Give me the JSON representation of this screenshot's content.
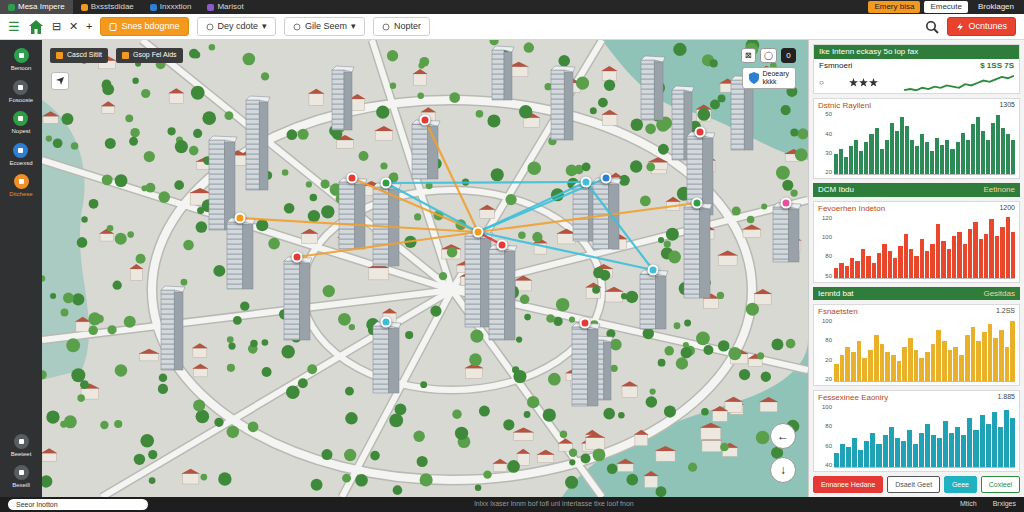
{
  "tabstrip": {
    "tabs": [
      {
        "label": "Mesa Impere",
        "selected": true,
        "color": "#2e9e4f"
      },
      {
        "label": "Bxsstsdidae",
        "selected": false,
        "color": "#f29a1f"
      },
      {
        "label": "Inxxxtion",
        "selected": false,
        "color": "#2d7fd3"
      },
      {
        "label": "Marisot",
        "selected": false,
        "color": "#8a5cc8"
      }
    ],
    "chips": [
      {
        "label": "Emery bisa",
        "kind": "orange"
      },
      {
        "label": "Emecute",
        "kind": "light"
      },
      {
        "label": "Broklagen",
        "kind": "plain"
      }
    ]
  },
  "toolbar": {
    "menu_icon": "☰",
    "window_icons": [
      "⊟",
      "✕",
      "+"
    ],
    "primary": "Snes bdognne",
    "dropdowns": [
      {
        "label": "Dey cdote",
        "caret": "▾"
      },
      {
        "label": "Gile Seem",
        "caret": "▾"
      }
    ],
    "plain": "Nopter",
    "action": "Ocntunes"
  },
  "sidebar": {
    "items": [
      {
        "label": "Benoon",
        "color": "#2e9e4f",
        "selected": false
      },
      {
        "label": "Fosoosie",
        "color": "#5a5d60",
        "selected": false
      },
      {
        "label": "Nopest",
        "color": "#2ea043",
        "selected": false
      },
      {
        "label": "Ecoexsd",
        "color": "#2d7fd3",
        "selected": false
      },
      {
        "label": "Ditchese",
        "color": "#f0902a",
        "selected": true
      }
    ],
    "footer_items": [
      {
        "label": "Beeteet",
        "color": "#5a5d60",
        "selected": false
      },
      {
        "label": "Bexeill",
        "color": "#5a5d60",
        "selected": false
      }
    ]
  },
  "map": {
    "chips": [
      "Cascd Sitiit",
      "Gsop Fel Aids"
    ],
    "tools": [
      {
        "label": "⊠",
        "selected": false
      },
      {
        "label": "◯",
        "selected": false
      },
      {
        "label": "0",
        "selected": true
      }
    ],
    "badge": {
      "title": "Deoeary",
      "sub": "kkkk"
    },
    "zoom": [
      "←",
      "↓"
    ],
    "pins": [
      {
        "color": "#e53935"
      },
      {
        "color": "#e53935"
      },
      {
        "color": "#2ea043"
      },
      {
        "color": "#f39a1e"
      },
      {
        "color": "#3cc0d8"
      },
      {
        "color": "#2d7fd3"
      },
      {
        "color": "#e53935"
      },
      {
        "color": "#2ea043"
      },
      {
        "color": "#e94f9a"
      },
      {
        "color": "#f39a1e"
      },
      {
        "color": "#e53935"
      },
      {
        "color": "#e53935"
      },
      {
        "color": "#3cc0d8"
      },
      {
        "color": "#3cc0d8"
      },
      {
        "color": "#e53935"
      }
    ],
    "links": [
      {
        "from": 3,
        "to": 0,
        "color": "#f0a030"
      },
      {
        "from": 3,
        "to": 1,
        "color": "#f0a030"
      },
      {
        "from": 3,
        "to": 2,
        "color": "#3cc0d8"
      },
      {
        "from": 3,
        "to": 4,
        "color": "#3cc0d8"
      },
      {
        "from": 3,
        "to": 5,
        "color": "#3cc0d8"
      },
      {
        "from": 3,
        "to": 7,
        "color": "#f0a030"
      },
      {
        "from": 3,
        "to": 9,
        "color": "#f0a030"
      },
      {
        "from": 3,
        "to": 10,
        "color": "#f0a030"
      },
      {
        "from": 3,
        "to": 11,
        "color": "#e53935"
      },
      {
        "from": 3,
        "to": 12,
        "color": "#3cc0d8"
      },
      {
        "from": 2,
        "to": 4,
        "color": "#3cc0d8"
      },
      {
        "from": 4,
        "to": 12,
        "color": "#3cc0d8"
      }
    ]
  },
  "panel": {
    "summary": {
      "title": "Ike Intenn eckasy 5o lop fax",
      "label": "Fsmnoeri",
      "reading": "$ 1SS 7S",
      "status_icon": "○",
      "stars": 3,
      "trend": [
        3,
        4,
        3,
        5,
        4,
        6,
        5,
        7,
        6,
        5,
        8,
        7,
        9,
        11,
        10,
        12,
        14,
        13,
        15
      ]
    },
    "charts": [
      {
        "title": "Dstnic Rayllenl",
        "value": "1305",
        "ticks": [
          "50",
          "40",
          "30",
          "20"
        ],
        "axis_max": 55,
        "color": "#2e8b57",
        "values": [
          18,
          22,
          15,
          25,
          30,
          20,
          28,
          35,
          40,
          22,
          30,
          45,
          38,
          50,
          42,
          30,
          25,
          35,
          28,
          20,
          32,
          26,
          30,
          22,
          28,
          36,
          30,
          44,
          50,
          38,
          30,
          45,
          52,
          40,
          35,
          30
        ]
      },
      {
        "header": {
          "title": "DCM Ibdu",
          "right": "Eetinone"
        },
        "title": "Fevoerhen Indeton",
        "value": "1200",
        "ticks": [
          "120",
          "100",
          "80",
          "50"
        ],
        "axis_max": 130,
        "color": "#e8472b",
        "values": [
          20,
          30,
          25,
          40,
          35,
          60,
          45,
          30,
          50,
          70,
          55,
          40,
          65,
          90,
          60,
          45,
          80,
          55,
          70,
          110,
          75,
          60,
          85,
          95,
          70,
          100,
          115,
          80,
          90,
          120,
          85,
          105,
          125,
          95
        ]
      },
      {
        "header": {
          "title": "Ienntd bat",
          "right": "Gesitdas"
        },
        "title": "Fsnaetsten",
        "value": "1.2SS",
        "ticks": [
          "100",
          "80",
          "20",
          "20"
        ],
        "axis_max": 110,
        "color": "#e9b12a",
        "values": [
          30,
          45,
          60,
          50,
          70,
          40,
          55,
          80,
          65,
          50,
          45,
          35,
          60,
          75,
          55,
          40,
          50,
          65,
          90,
          70,
          55,
          60,
          45,
          80,
          95,
          70,
          85,
          100,
          75,
          90,
          60,
          105
        ]
      },
      {
        "title": "Fessexinee Eaoniry",
        "value": "1.885",
        "ticks": [
          "100",
          "80",
          "60",
          "40"
        ],
        "axis_max": 110,
        "color": "#1fa2b5",
        "values": [
          25,
          40,
          35,
          50,
          30,
          45,
          60,
          40,
          55,
          70,
          50,
          45,
          65,
          40,
          60,
          75,
          55,
          50,
          80,
          60,
          70,
          55,
          85,
          65,
          90,
          75,
          95,
          70,
          100,
          85
        ]
      }
    ],
    "buttons": [
      {
        "label": "Ennanee Hedane",
        "color": "#e53935",
        "kind": "filled"
      },
      {
        "label": "Dsaeit Geet",
        "color": "#555555",
        "kind": "outline"
      },
      {
        "label": "Geee",
        "color": "#20b2c0",
        "kind": "filled"
      },
      {
        "label": "Coxieel",
        "color": "#2e8b3e",
        "kind": "outline"
      }
    ]
  },
  "status_bar": {
    "search": "Seeor lnotton",
    "message": "lnlxx lxaser lnnm bof tofl unl lnterlasse tlxe loof fnon",
    "items": [
      "Mtich",
      "Brxiges"
    ]
  }
}
